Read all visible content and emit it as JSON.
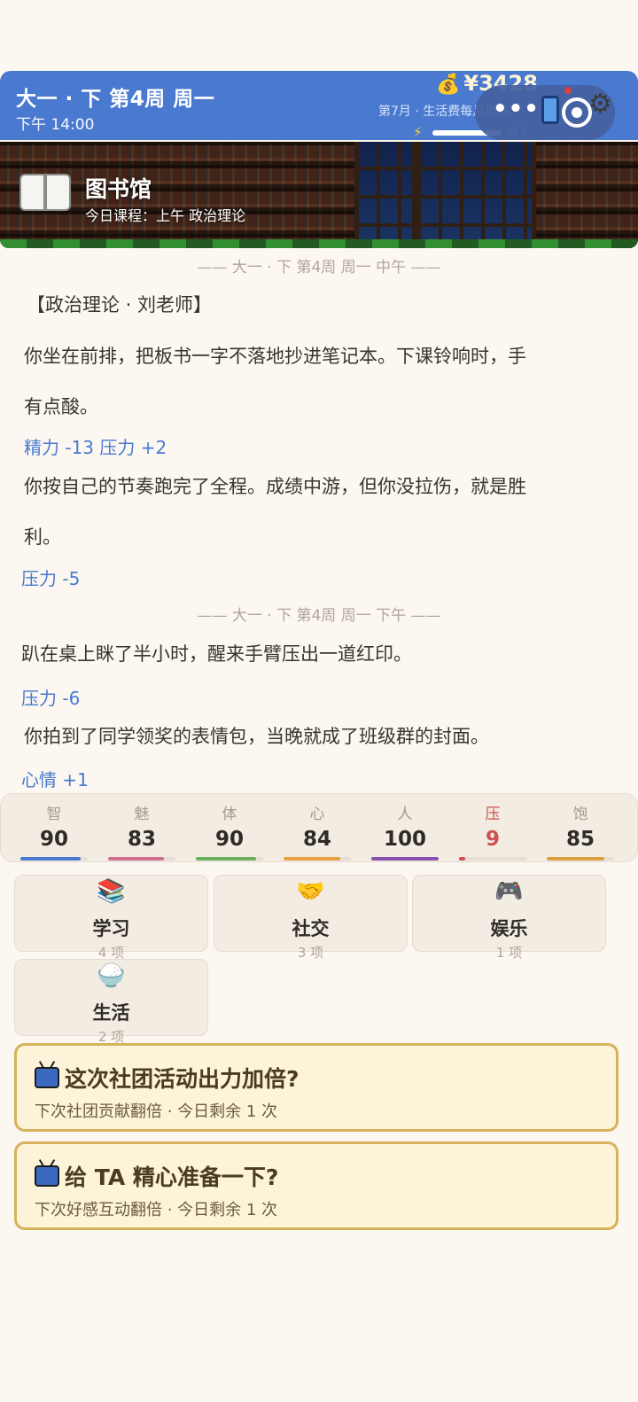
{
  "header": {
    "term_week_day": "大一 · 下 第4周 周一",
    "time": "下午  14:00",
    "money": "¥3428",
    "money_icon": "money-bag-icon",
    "allowance_note": "第7月 · 生活费每月到账",
    "energy_value": "93",
    "energy_fraction": 0.93
  },
  "capsule": {
    "more_label": "•••"
  },
  "location": {
    "name": "图书馆",
    "courses_today": "今日课程：上午 政治理论"
  },
  "log": {
    "sep_noon": "—— 大一 · 下 第4周 周一 中午 ——",
    "class_header": "【政治理论 · 刘老师】",
    "entry1_line1": "你坐在前排，把板书一字不落地抄进笔记本。下课铃响时，手",
    "entry1_line2": "有点酸。",
    "entry1_delta": "精力 -13  压力 +2",
    "entry2_line1": "你按自己的节奏跑完了全程。成绩中游，但你没拉伤，就是胜",
    "entry2_line2": "利。",
    "entry2_delta": "压力 -5",
    "sep_afternoon": "—— 大一 · 下 第4周 周一 下午 ——",
    "entry3": "趴在桌上眯了半小时，醒来手臂压出一道红印。",
    "entry3_delta": "压力 -6",
    "entry4": "你拍到了同学领奖的表情包，当晚就成了班级群的封面。",
    "entry4_delta": "心情 +1"
  },
  "stats": [
    {
      "label": "智",
      "value": "90",
      "fraction": 0.9,
      "color": "#4a7ad0"
    },
    {
      "label": "魅",
      "value": "83",
      "fraction": 0.83,
      "color": "#d07090"
    },
    {
      "label": "体",
      "value": "90",
      "fraction": 0.9,
      "color": "#6ab060"
    },
    {
      "label": "心",
      "value": "84",
      "fraction": 0.84,
      "color": "#e8a040"
    },
    {
      "label": "人",
      "value": "100",
      "fraction": 1.0,
      "color": "#8a50b0"
    },
    {
      "label": "压",
      "value": "9",
      "fraction": 0.09,
      "color": "#d05050"
    },
    {
      "label": "饱",
      "value": "85",
      "fraction": 0.85,
      "color": "#d8a040"
    }
  ],
  "categories": [
    {
      "name": "学习",
      "count": "4 项",
      "icon": "books-icon"
    },
    {
      "name": "社交",
      "count": "3 项",
      "icon": "handshake-icon"
    },
    {
      "name": "娱乐",
      "count": "1 项",
      "icon": "gamepad-icon"
    },
    {
      "name": "生活",
      "count": "2 项",
      "icon": "rice-bowl-icon"
    }
  ],
  "ads": [
    {
      "title": "这次社团活动出力加倍?",
      "subtitle": "下次社团贡献翻倍 · 今日剩余 1 次"
    },
    {
      "title": "给 TA 精心准备一下?",
      "subtitle": "下次好感互动翻倍 · 今日剩余 1 次"
    }
  ],
  "colors": {
    "header_bg": "#4a7ad0",
    "delta_text": "#4a7ad0",
    "ad_border": "#d8b25a",
    "page_bg": "#fcf7f1"
  }
}
